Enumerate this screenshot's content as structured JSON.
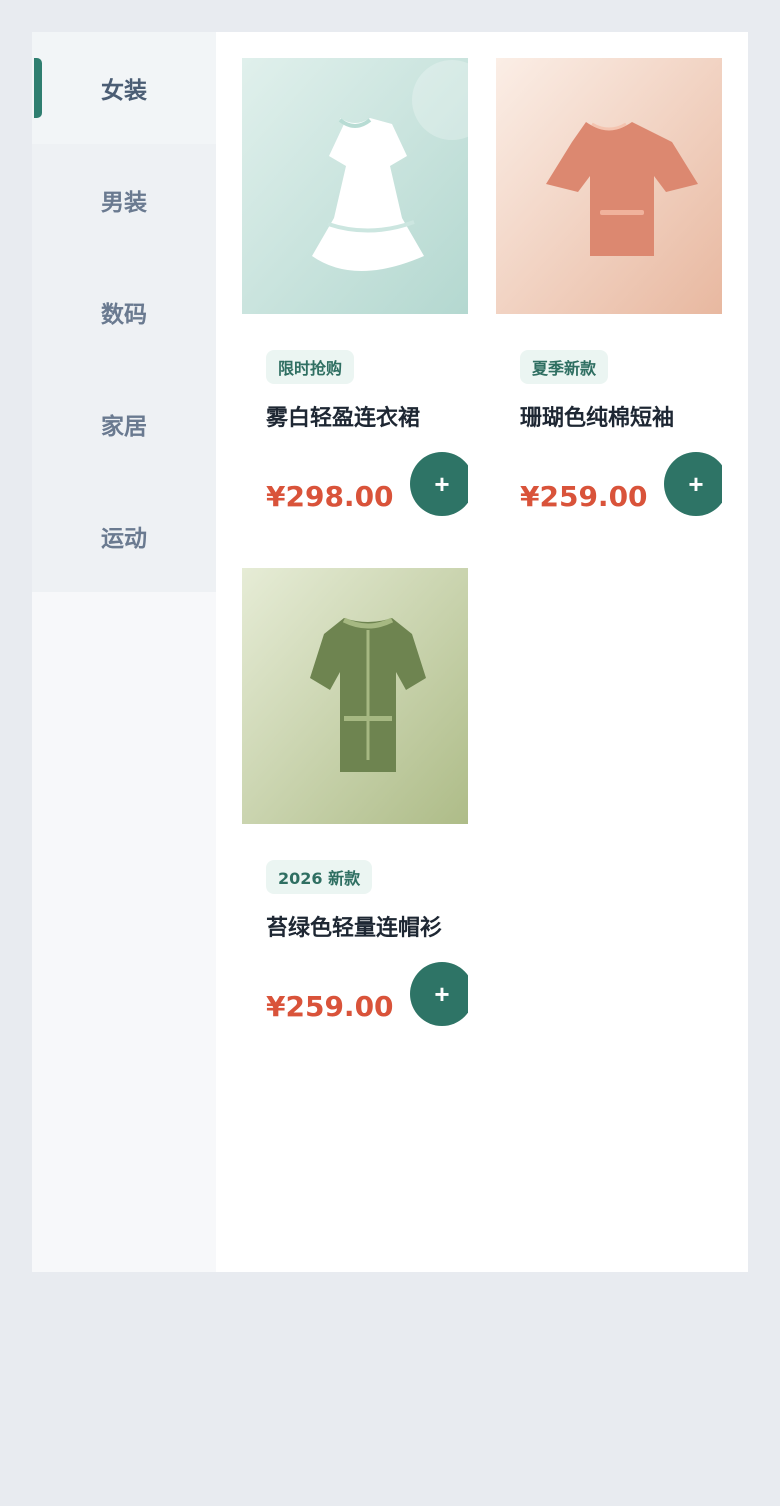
{
  "sidebar": {
    "items": [
      {
        "label": "女装",
        "active": true
      },
      {
        "label": "男装",
        "active": false
      },
      {
        "label": "数码",
        "active": false
      },
      {
        "label": "家居",
        "active": false
      },
      {
        "label": "运动",
        "active": false
      }
    ]
  },
  "products": [
    {
      "tag": "限时抢购",
      "name": "雾白轻盈连衣裙",
      "price": "¥298.00",
      "add_label": "+",
      "image_icon": "dress-icon"
    },
    {
      "tag": "夏季新款",
      "name": "珊瑚色纯棉短袖",
      "price": "¥259.00",
      "add_label": "+",
      "image_icon": "tshirt-icon"
    },
    {
      "tag": "2026 新款",
      "name": "苔绿色轻量连帽衫",
      "price": "¥259.00",
      "add_label": "+",
      "image_icon": "hoodie-icon"
    }
  ],
  "colors": {
    "accent": "#2e7466",
    "price": "#d9533a",
    "tag_bg": "#ebf5f2"
  }
}
